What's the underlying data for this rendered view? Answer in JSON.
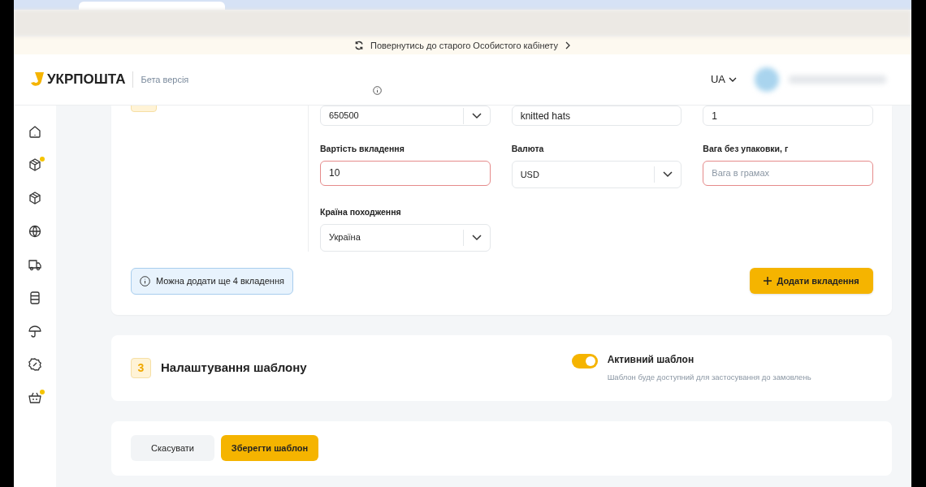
{
  "banner": {
    "text": "Повернутись до старого Особистого кабінету"
  },
  "header": {
    "logo": "УКРПОШТА",
    "subtitle": "Бета версія",
    "language": "UA"
  },
  "sidebar": {
    "items": [
      {
        "kind": "home",
        "notified": false
      },
      {
        "kind": "parcel",
        "notified": true
      },
      {
        "kind": "parcel",
        "notified": false
      },
      {
        "kind": "globe",
        "notified": false
      },
      {
        "kind": "truck",
        "notified": false
      },
      {
        "kind": "stack",
        "notified": false
      },
      {
        "kind": "umbrella",
        "notified": false
      },
      {
        "kind": "discount",
        "notified": false
      },
      {
        "kind": "basket",
        "notified": true
      }
    ]
  },
  "attachment_form": {
    "top_row": [
      {
        "kind": "select",
        "value": "650500"
      },
      {
        "kind": "text",
        "value": "knitted hats"
      },
      {
        "kind": "text",
        "value": "1"
      }
    ],
    "fields": [
      {
        "label": "Вартість вкладення",
        "kind": "text",
        "value": "10",
        "error": true
      },
      {
        "label": "Валюта",
        "kind": "select",
        "value": "USD",
        "error": false
      },
      {
        "label": "Вага без упаковки, г",
        "kind": "text",
        "placeholder": "Вага в грамах",
        "error": true
      },
      {
        "label": "Країна походження",
        "kind": "select",
        "value": "Україна",
        "error": false
      }
    ],
    "note": "Можна додати ще 4 вкладення",
    "add_button": "Додати вкладення"
  },
  "template_settings": {
    "number": "3",
    "title": "Налаштування шаблону",
    "toggle": {
      "on": true,
      "label": "Активний шаблон",
      "description": "Шаблон буде доступний для застосування до замовлень"
    }
  },
  "actions": {
    "cancel": "Скасувати",
    "save": "Зберегти шаблон"
  }
}
